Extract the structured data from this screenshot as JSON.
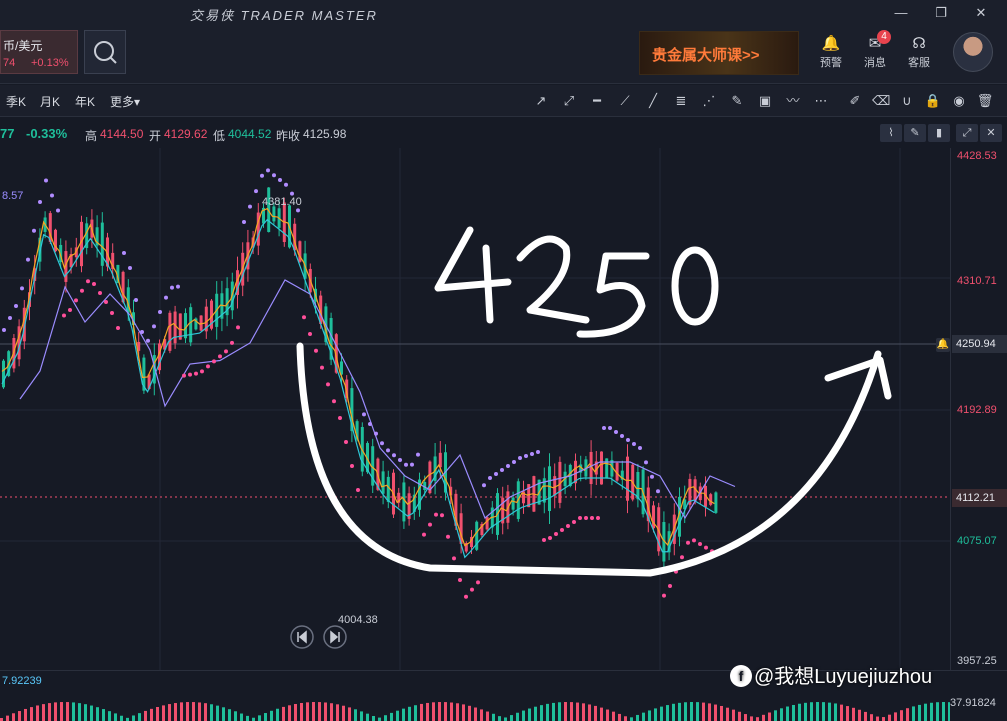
{
  "app": {
    "title": "交易侠  TRADER MASTER"
  },
  "window": {
    "minimize": "—",
    "restore": "❐",
    "close": "✕"
  },
  "symbol": {
    "name": "币/美元",
    "price": "74",
    "change": "+0.13%"
  },
  "banner": {
    "text": "贵金属大师课>>"
  },
  "header_items": [
    {
      "label": "预警",
      "icon": "bell-icon"
    },
    {
      "label": "消息",
      "icon": "mail-icon",
      "badge": "4"
    },
    {
      "label": "客服",
      "icon": "headset-icon"
    }
  ],
  "timeframes": [
    "季K",
    "月K",
    "年K",
    "更多"
  ],
  "info": {
    "price": "77",
    "change": "-0.33%",
    "high_label": "高",
    "high": "4144.50",
    "open_label": "开",
    "open": "4129.62",
    "low_label": "低",
    "low": "4044.52",
    "prev_label": "昨收",
    "prev": "4125.98"
  },
  "axis": {
    "labels": [
      "4428.53",
      "4310.71",
      "4192.89",
      "4112.21",
      "4075.07",
      "3957.25"
    ],
    "highlight": "4250.94"
  },
  "chart_data": {
    "type": "candlestick",
    "annotations": [
      "4381.40",
      "4004.38",
      "8.57",
      "4250"
    ],
    "indicator_left": "7.92239",
    "indicator_right": "37.91824"
  },
  "watermark": {
    "text": "@我想Luyuejiuzhou"
  },
  "colors": {
    "up": "#1fbf9b",
    "down": "#f0506e",
    "bg": "#161a25"
  }
}
